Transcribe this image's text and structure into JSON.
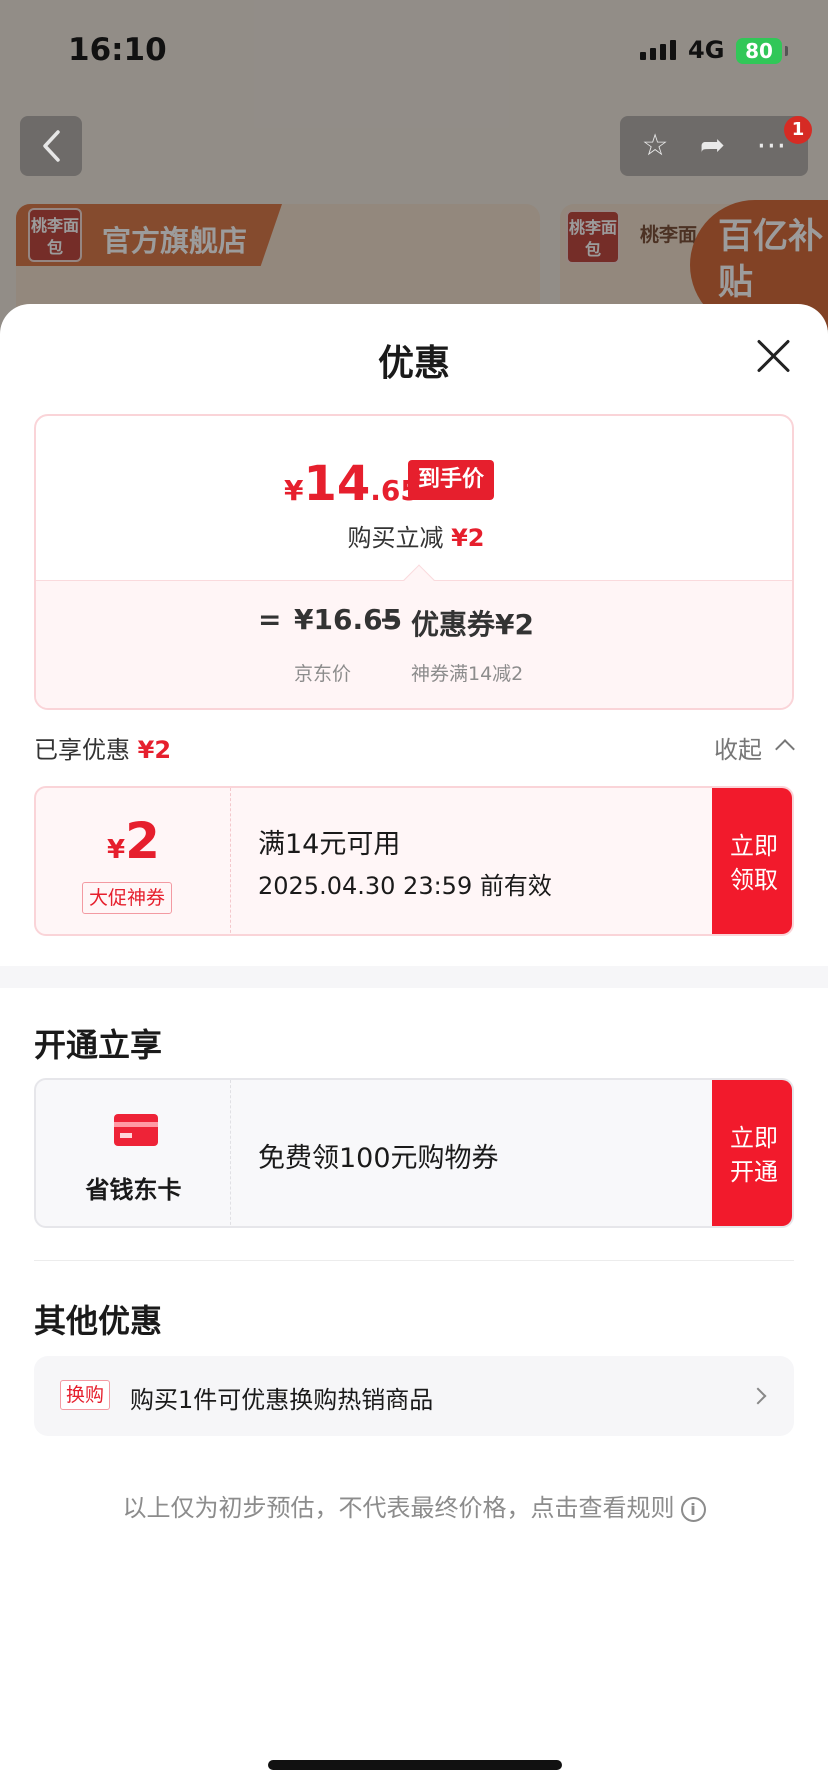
{
  "status_bar": {
    "time": "16:10",
    "network": "4G",
    "battery": "80"
  },
  "background": {
    "store_logo": "桃李面包",
    "store_name": "官方旗舰店",
    "brand_partial": "桃李面",
    "subsidy_label": "百亿补贴",
    "notification_count": "1",
    "icons": [
      "back-icon",
      "star-icon",
      "share-icon",
      "more-icon"
    ]
  },
  "sheet": {
    "title": "优惠",
    "price_summary": {
      "yen": "¥",
      "final_int": "14",
      "final_dec": ".65",
      "final_tag": "到手价",
      "instant_off_label": "购买立减",
      "instant_off_value": "¥2",
      "equals": "=",
      "jd_price": "¥16.65",
      "minus": "−",
      "coupon_label": "优惠券¥2",
      "jd_price_caption": "京东价",
      "coupon_caption": "神券满14减2"
    },
    "enjoyed_label": "已享优惠",
    "enjoyed_value": "¥2",
    "collapse_label": "收起",
    "coupon": {
      "yen": "¥",
      "amount": "2",
      "type": "大促神券",
      "condition": "满14元可用",
      "expiry": "2025.04.30 23:59 前有效",
      "button_line1": "立即",
      "button_line2": "领取"
    },
    "membership_section_title": "开通立享",
    "membership": {
      "name": "省钱东卡",
      "description": "免费领100元购物券",
      "button_line1": "立即",
      "button_line2": "开通"
    },
    "other_section_title": "其他优惠",
    "other": {
      "tag": "换购",
      "text": "购买1件可优惠换购热销商品"
    },
    "disclaimer": "以上仅为初步预估，不代表最终价格，点击查看规则",
    "info_glyph": "i"
  },
  "colors": {
    "accent": "#e61f2d",
    "button": "#f21a2c"
  }
}
